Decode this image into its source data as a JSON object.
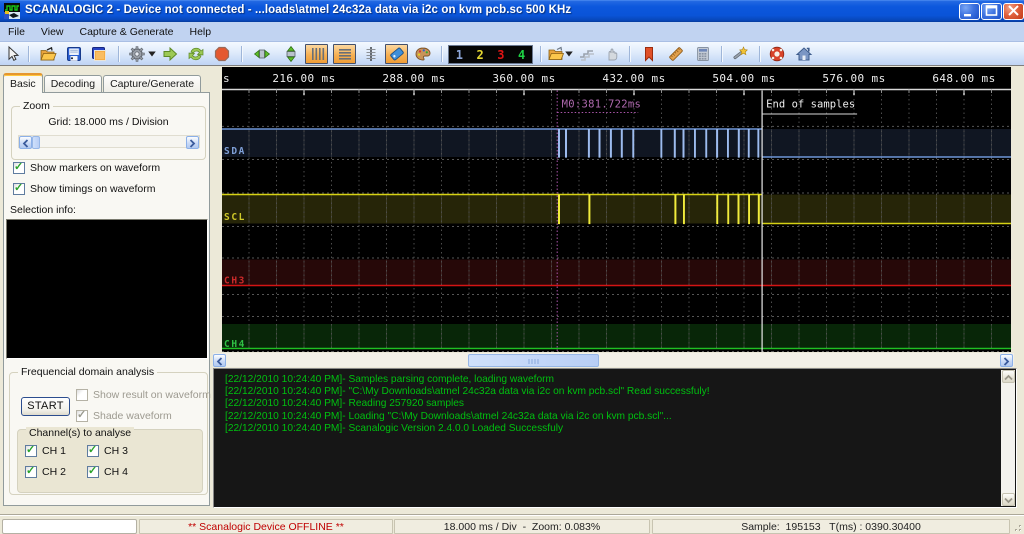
{
  "window": {
    "title": "SCANALOGIC 2 - Device not connected - ...loads\\atmel 24c32a data via i2c on kvm pcb.sc 500 KHz"
  },
  "menu": {
    "items": [
      "File",
      "View",
      "Capture & Generate",
      "Help"
    ]
  },
  "toolbar": {
    "channel_buttons": [
      {
        "label": "1",
        "color": "#8da6d8"
      },
      {
        "label": "2",
        "color": "#e6d832"
      },
      {
        "label": "3",
        "color": "#e01414"
      },
      {
        "label": "4",
        "color": "#1ed245"
      }
    ]
  },
  "sidebar": {
    "tabs": [
      {
        "label": "Basic",
        "active": true
      },
      {
        "label": "Decoding",
        "active": false
      },
      {
        "label": "Capture/Generate",
        "active": false
      }
    ],
    "zoom_group": {
      "label": "Zoom",
      "grid_text": "Grid: 18.000 ms / Division"
    },
    "options": [
      {
        "label": "Show markers on waveform",
        "checked": true
      },
      {
        "label": "Show timings on waveform",
        "checked": true
      }
    ],
    "selection_label": "Selection info:",
    "fda_group": {
      "label": "Frequencial domain analysis",
      "start_button": "START",
      "options": [
        {
          "label": "Show result on waveform",
          "checked": false,
          "disabled": true
        },
        {
          "label": "Shade waveform",
          "checked": true,
          "disabled": true
        }
      ],
      "channels_group": {
        "label": "Channel(s) to analyse",
        "checkboxes": [
          {
            "label": "CH 1",
            "checked": true
          },
          {
            "label": "CH 3",
            "checked": true
          },
          {
            "label": "CH 2",
            "checked": true
          },
          {
            "label": "CH 4",
            "checked": true
          }
        ]
      }
    }
  },
  "chart_data": {
    "type": "line",
    "subtype": "logic-analyzer-timing-waveform",
    "x_unit": "ms",
    "division_ms": 18,
    "ruler_ticks_ms": [
      216,
      288,
      360,
      432,
      504,
      576,
      648
    ],
    "ruler_tick_labels": [
      "216.00 ms",
      "288.00 ms",
      "360.00 ms",
      "432.00 ms",
      "504.00 ms",
      "576.00 ms",
      "648.00 ms"
    ],
    "ruler_left_partial_label": "s",
    "x_range_ms": [
      162.3,
      678.7
    ],
    "grid": true,
    "channels": [
      {
        "name": "SDA",
        "color": "#9dbbee",
        "dim_color": "#6e95d8",
        "label_color": "#7fa0d8",
        "band_color": "#101622",
        "idle_level": "high",
        "pulse_width_ms": 0.5,
        "pulses_ms": [
          382.9,
          387.5,
          402.5,
          409.4,
          416.9,
          424.0,
          431.5,
          449.9,
          458.7,
          464.4,
          471.9,
          479.3,
          486.4,
          493.5,
          500.6,
          507.1,
          513.4
        ]
      },
      {
        "name": "SCL",
        "color": "#f0ec3c",
        "dim_color": "#d6d214",
        "label_color": "#cfc929",
        "band_color": "#262508",
        "idle_level": "high",
        "pulse_width_ms": 0.5,
        "pulses_ms": [
          382.9,
          402.8,
          459.1,
          464.7,
          486.5,
          493.7,
          500.4,
          507.3,
          513.7
        ]
      },
      {
        "name": "CH3",
        "color": "#d41414",
        "dim_color": "#b01212",
        "label_color": "#cc2a2a",
        "band_color": "#260808",
        "idle_level": "low",
        "pulse_width_ms": 0,
        "pulses_ms": []
      },
      {
        "name": "CH4",
        "color": "#1fc024",
        "dim_color": "#18a81e",
        "label_color": "#2fc045",
        "band_color": "#082608",
        "idle_level": "low",
        "pulse_width_ms": 0,
        "pulses_ms": []
      }
    ],
    "markers": [
      {
        "label": "M0:381.722ms",
        "t_ms": 381.722,
        "color": "#aa55aa"
      }
    ],
    "end_marker": {
      "label": "End of samples",
      "t_ms": 515.84,
      "color": "#e9e9e9"
    }
  },
  "log": {
    "lines": [
      "[22/12/2010 10:24:40 PM]- Samples parsing complete, loading waveform",
      "[22/12/2010 10:24:40 PM]- \"C:\\My Downloads\\atmel 24c32a data via i2c on kvm pcb.scl\" Read successfuly!",
      "[22/12/2010 10:24:40 PM]- Reading 257920 samples",
      "[22/12/2010 10:24:40 PM]- Loading \"C:\\My Downloads\\atmel 24c32a data via i2c on kvm pcb.scl\"...",
      "[22/12/2010 10:24:40 PM]- Scanalogic Version  2.4.0.0 Loaded Successfuly"
    ]
  },
  "statusbar": {
    "offline": "** Scanalogic Device OFFLINE **",
    "zoom": "18.000 ms / Div  -  Zoom: 0.083%",
    "sample": "Sample:  195153   T(ms) : 0390.30400"
  }
}
